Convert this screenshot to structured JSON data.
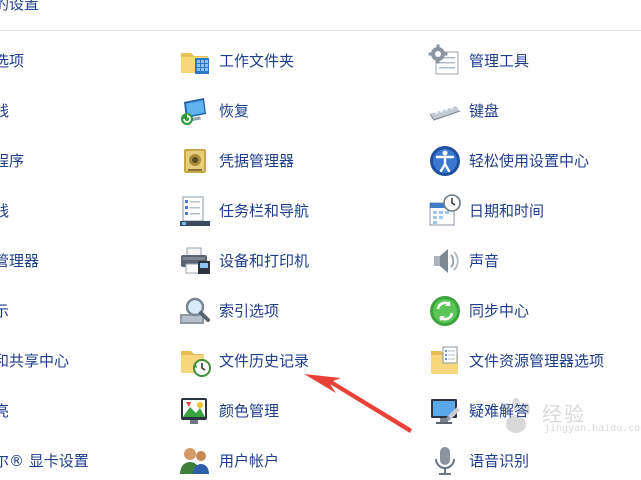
{
  "header": {
    "title": "的设置"
  },
  "columns": {
    "left": [
      "选项",
      "线",
      "程序",
      "线",
      "管理器",
      "示",
      "和共享中心",
      "亮",
      "尔® 显卡设置"
    ],
    "middle": [
      "工作文件夹",
      "恢复",
      "凭据管理器",
      "任务栏和导航",
      "设备和打印机",
      "索引选项",
      "文件历史记录",
      "颜色管理",
      "用户帐户"
    ],
    "right": [
      "管理工具",
      "键盘",
      "轻松使用设置中心",
      "日期和时间",
      "声音",
      "同步中心",
      "文件资源管理器选项",
      "疑难解答",
      "语音识别"
    ]
  },
  "watermark": {
    "text": "经验",
    "sub": "jingyan.baidu.com"
  },
  "icons": {
    "middle": [
      "work-folders-icon",
      "recovery-icon",
      "credential-manager-icon",
      "taskbar-icon",
      "devices-printers-icon",
      "indexing-icon",
      "file-history-icon",
      "color-management-icon",
      "user-accounts-icon"
    ],
    "right": [
      "admin-tools-icon",
      "keyboard-icon",
      "ease-of-access-icon",
      "date-time-icon",
      "sound-icon",
      "sync-center-icon",
      "folder-options-icon",
      "troubleshooting-icon",
      "speech-recognition-icon"
    ]
  },
  "colors": {
    "link": "#1e3e8c",
    "arrow": "#e8413a"
  }
}
